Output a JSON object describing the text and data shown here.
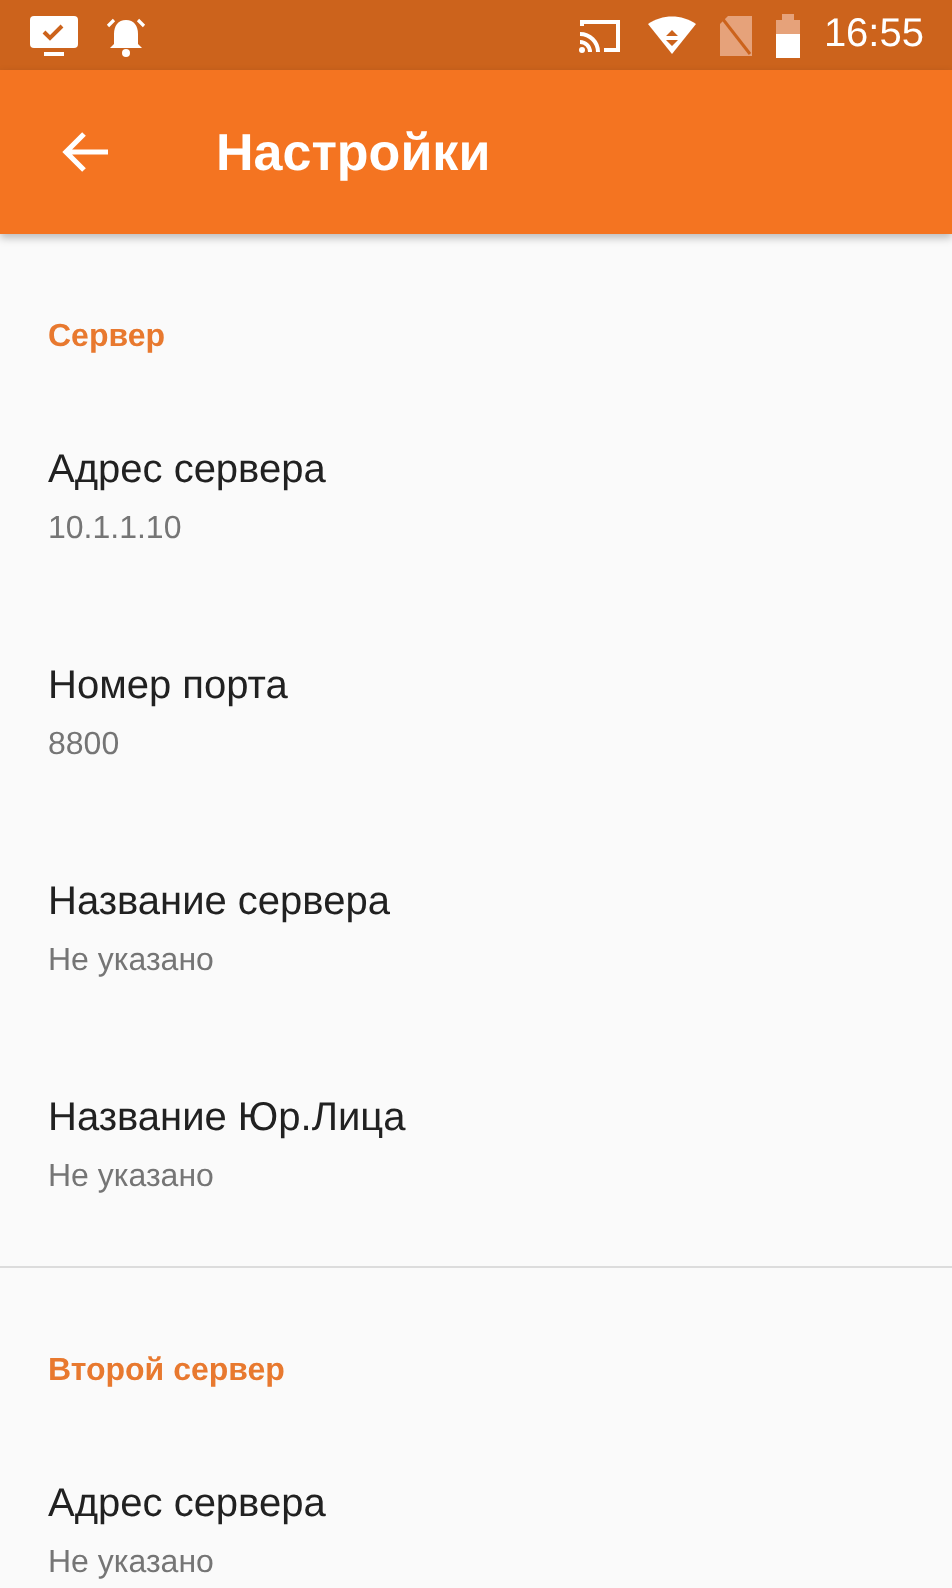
{
  "status_bar": {
    "time": "16:55"
  },
  "app_bar": {
    "title": "Настройки"
  },
  "sections": [
    {
      "title": "Сервер",
      "items": [
        {
          "title": "Адрес сервера",
          "summary": "10.1.1.10"
        },
        {
          "title": "Номер порта",
          "summary": "8800"
        },
        {
          "title": "Название сервера",
          "summary": "Не указано"
        },
        {
          "title": "Название Юр.Лица",
          "summary": "Не указано"
        }
      ]
    },
    {
      "title": "Второй сервер",
      "items": [
        {
          "title": "Адрес сервера",
          "summary": "Не указано"
        }
      ]
    }
  ]
}
